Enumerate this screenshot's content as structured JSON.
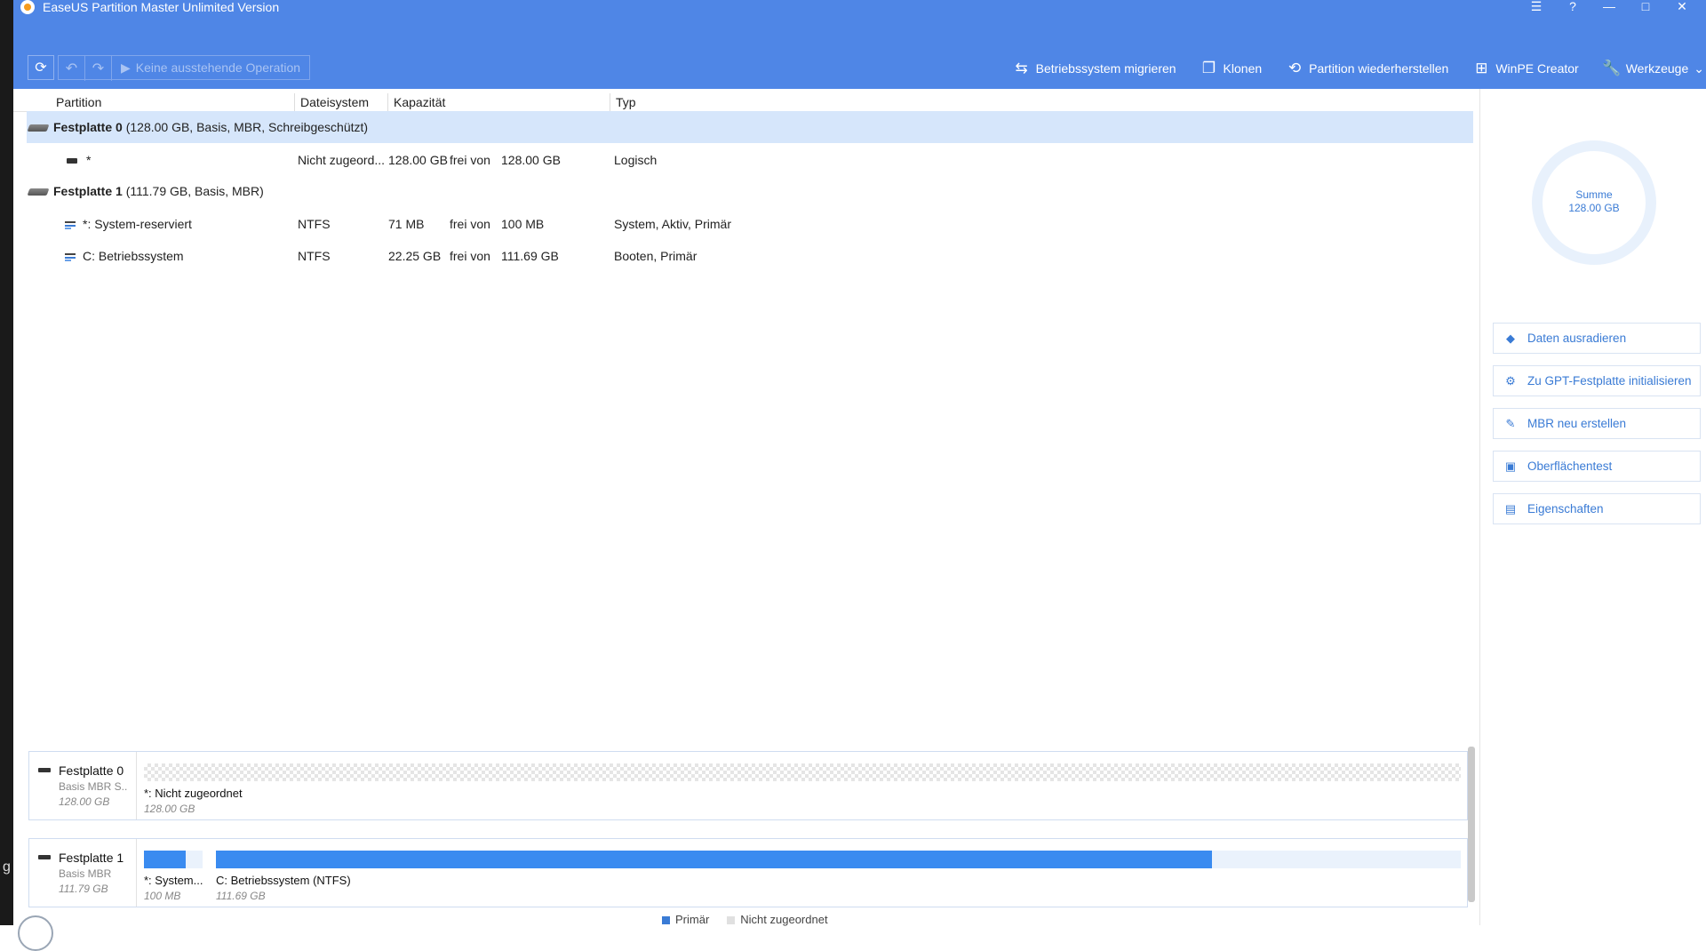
{
  "app": {
    "title": "EaseUS Partition Master Unlimited Version"
  },
  "window_controls": {
    "menu": "☰",
    "help": "?",
    "minimize": "—",
    "maximize": "□",
    "close": "✕"
  },
  "toolbar": {
    "pending_label": "Keine ausstehende Operation",
    "tools": [
      {
        "label": "Betriebssystem migrieren",
        "icon": "migrate-icon"
      },
      {
        "label": "Klonen",
        "icon": "clone-icon"
      },
      {
        "label": "Partition wiederherstellen",
        "icon": "restore-partition-icon"
      },
      {
        "label": "WinPE Creator",
        "icon": "windows-icon"
      },
      {
        "label": "Werkzeuge",
        "icon": "wrench-icon"
      }
    ]
  },
  "table": {
    "headers": [
      "Partition",
      "Dateisystem",
      "Kapazität",
      "Typ"
    ],
    "rows": [
      {
        "kind": "disk",
        "name": "Festplatte 0",
        "info": "(128.00 GB, Basis, MBR, Schreibgeschützt)",
        "selected": true
      },
      {
        "kind": "part",
        "name": "*",
        "fs": "Nicht zugeord...",
        "used": "128.00 GB",
        "frei": "frei von",
        "total": "128.00 GB",
        "type": "Logisch"
      },
      {
        "kind": "disk",
        "name": "Festplatte 1",
        "info": "(111.79 GB, Basis, MBR)"
      },
      {
        "kind": "part",
        "name": "*: System-reserviert",
        "fs": "NTFS",
        "used": "71 MB",
        "frei": "frei von",
        "total": "100 MB",
        "type": "System, Aktiv, Primär"
      },
      {
        "kind": "part",
        "name": "C: Betriebssystem",
        "fs": "NTFS",
        "used": "22.25 GB",
        "frei": "frei von",
        "total": "111.69 GB",
        "type": "Booten, Primär"
      }
    ]
  },
  "summary": {
    "label": "Summe",
    "value": "128.00 GB"
  },
  "actions": [
    {
      "label": "Daten ausradieren",
      "icon": "eraser-icon"
    },
    {
      "label": "Zu GPT-Festplatte initialisieren",
      "icon": "gear-icon"
    },
    {
      "label": "MBR neu erstellen",
      "icon": "mbr-icon"
    },
    {
      "label": "Oberflächentest",
      "icon": "surface-test-icon"
    },
    {
      "label": "Eigenschaften",
      "icon": "properties-icon"
    }
  ],
  "disk_map": [
    {
      "name": "Festplatte 0",
      "sub": "Basis MBR S..",
      "size": "128.00 GB",
      "partitions": [
        {
          "label": "*: Nicht zugeordnet",
          "size": "128.00 GB",
          "style": "unallocated"
        }
      ]
    },
    {
      "name": "Festplatte 1",
      "sub": "Basis MBR",
      "size": "111.79 GB",
      "partitions": [
        {
          "label": "*: System...",
          "size": "100 MB",
          "style": "primary",
          "used_fraction": 0.71
        },
        {
          "label": "C: Betriebssystem (NTFS)",
          "size": "111.69 GB",
          "style": "primary",
          "used_fraction": 0.8
        }
      ]
    }
  ],
  "legend": [
    {
      "label": "Primär",
      "color": "#3a7bd5"
    },
    {
      "label": "Nicht zugeordnet",
      "color": "#e0e0e0"
    }
  ],
  "left_edge_char": "g",
  "colors": {
    "header": "#4f86e6",
    "accent": "#3a7bd5",
    "selection": "#d6e6fb"
  }
}
